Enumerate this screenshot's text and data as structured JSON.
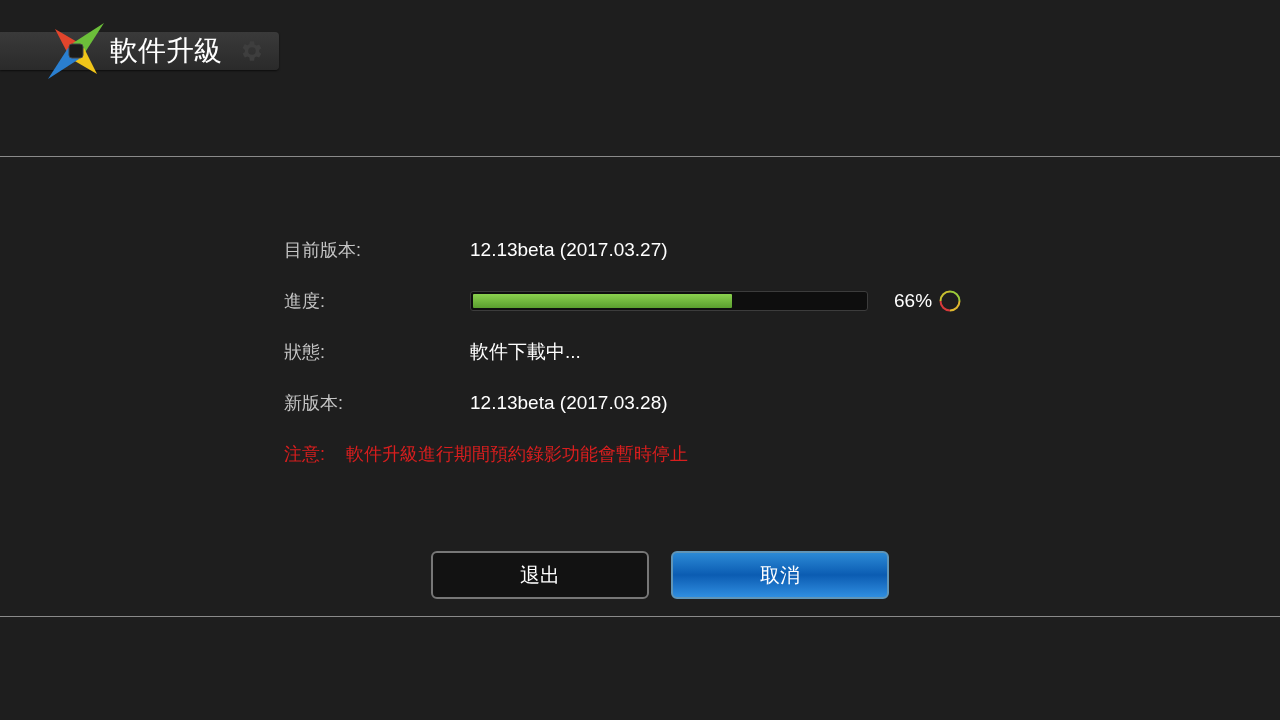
{
  "header": {
    "title": "軟件升級"
  },
  "fields": [
    {
      "kind": "text",
      "label": "目前版本:",
      "value": "12.13beta (2017.03.27)"
    },
    {
      "kind": "progress",
      "label": "進度:",
      "level": 0.66,
      "reading": "66%"
    },
    {
      "kind": "text",
      "label": "狀態:",
      "value": "軟件下載中..."
    },
    {
      "kind": "text",
      "label": "新版本:",
      "value": "12.13beta (2017.03.28)"
    }
  ],
  "notice": {
    "label": "注意:",
    "text": "軟件升級進行期間預約錄影功能會暫時停止"
  },
  "buttons": [
    {
      "label": "退出",
      "selected": false
    },
    {
      "label": "取消",
      "selected": true
    }
  ]
}
